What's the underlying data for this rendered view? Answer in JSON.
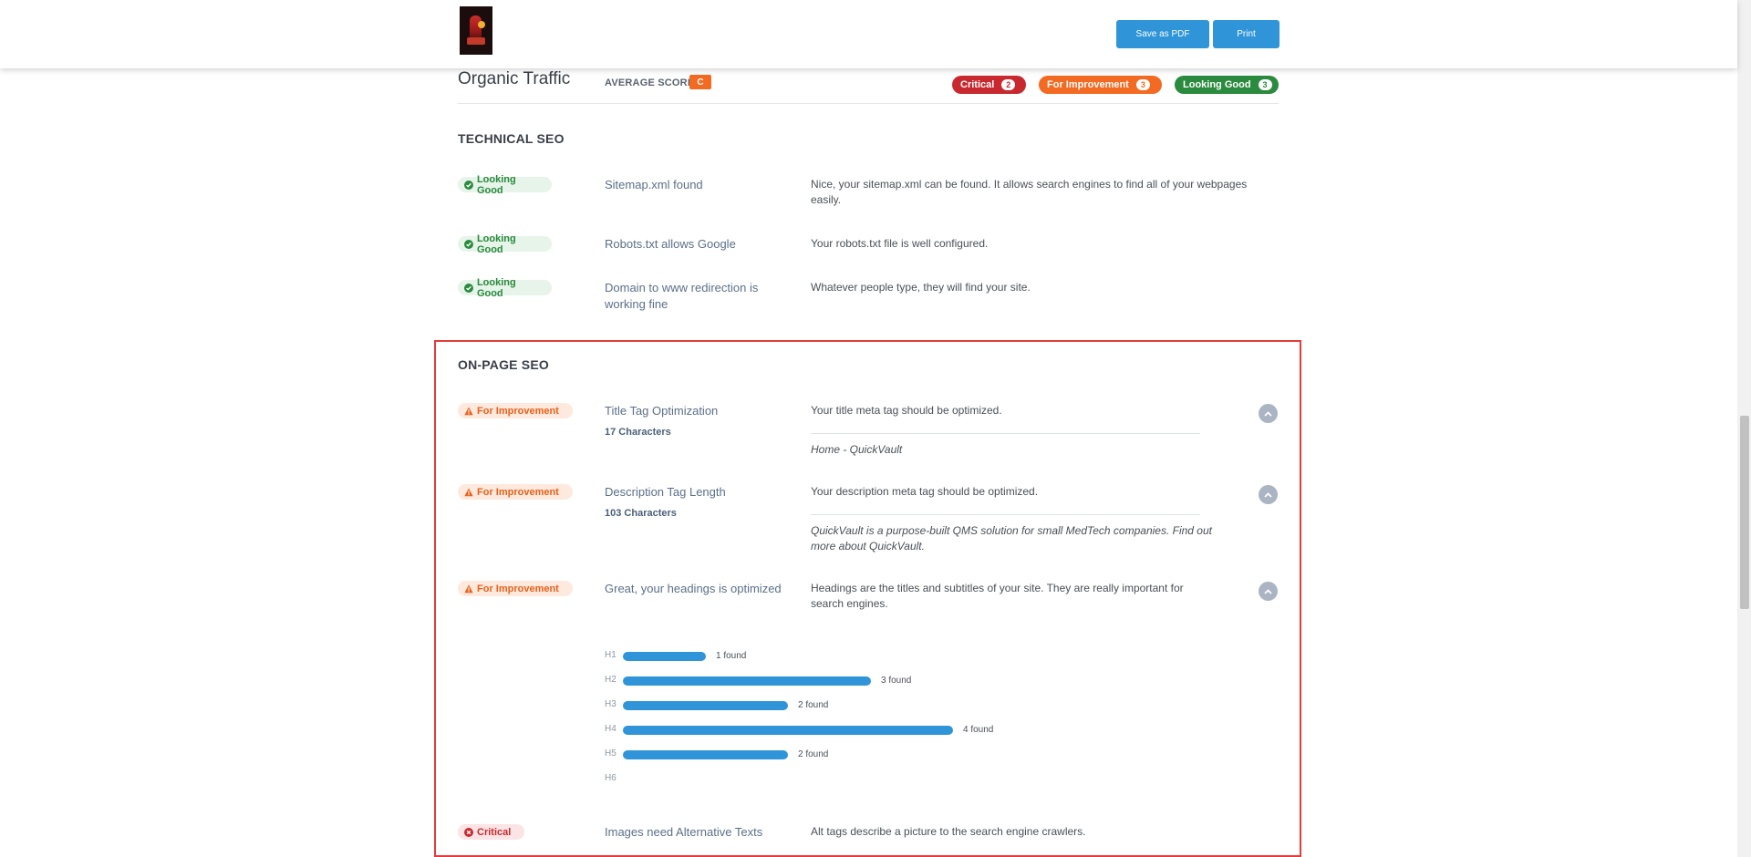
{
  "toolbar": {
    "save_pdf_label": "Save as PDF",
    "print_label": "Print"
  },
  "header": {
    "title": "Organic Traffic",
    "average_label": "AVERAGE SCORE:",
    "average_score": "C",
    "summary": {
      "critical_label": "Critical",
      "critical_count": "2",
      "improvement_label": "For Improvement",
      "improvement_count": "3",
      "good_label": "Looking Good",
      "good_count": "3"
    }
  },
  "technical": {
    "title": "TECHNICAL SEO",
    "items": [
      {
        "status": "Looking Good",
        "title": "Sitemap.xml found",
        "desc": "Nice, your sitemap.xml can be found. It allows search engines to find all of your webpages easily."
      },
      {
        "status": "Looking Good",
        "title": "Robots.txt allows Google",
        "desc": "Your robots.txt file is well configured."
      },
      {
        "status": "Looking Good",
        "title": "Domain to www redirection is working fine",
        "desc": "Whatever people type, they will find your site."
      }
    ]
  },
  "onpage": {
    "title": "ON-PAGE SEO",
    "items": [
      {
        "status": "For Improvement",
        "title": "Title Tag Optimization",
        "sub": "17 Characters",
        "desc": "Your title meta tag should be optimized.",
        "value": "Home - QuickVault"
      },
      {
        "status": "For Improvement",
        "title": "Description Tag Length",
        "sub": "103 Characters",
        "desc": "Your description meta tag should be optimized.",
        "value": "QuickVault is a purpose-built QMS solution for small MedTech companies. Find out more about QuickVault."
      },
      {
        "status": "For Improvement",
        "title": "Great, your headings is optimized",
        "desc": "Headings are the titles and subtitles of your site. They are really important for search engines."
      },
      {
        "status": "Critical",
        "title": "Images need Alternative Texts",
        "desc": "Alt tags describe a picture to the search engine crawlers."
      }
    ],
    "headings": [
      {
        "label": "H1",
        "count": 1,
        "text": "1 found"
      },
      {
        "label": "H2",
        "count": 3,
        "text": "3 found"
      },
      {
        "label": "H3",
        "count": 2,
        "text": "2 found"
      },
      {
        "label": "H4",
        "count": 4,
        "text": "4 found"
      },
      {
        "label": "H5",
        "count": 2,
        "text": "2 found"
      },
      {
        "label": "H6",
        "count": 0,
        "text": ""
      }
    ]
  },
  "colors": {
    "accent": "#2f95d8",
    "critical": "#c8292f",
    "improvement": "#f36a22",
    "good": "#2a8a3d",
    "highlight": "#e53b3b"
  }
}
